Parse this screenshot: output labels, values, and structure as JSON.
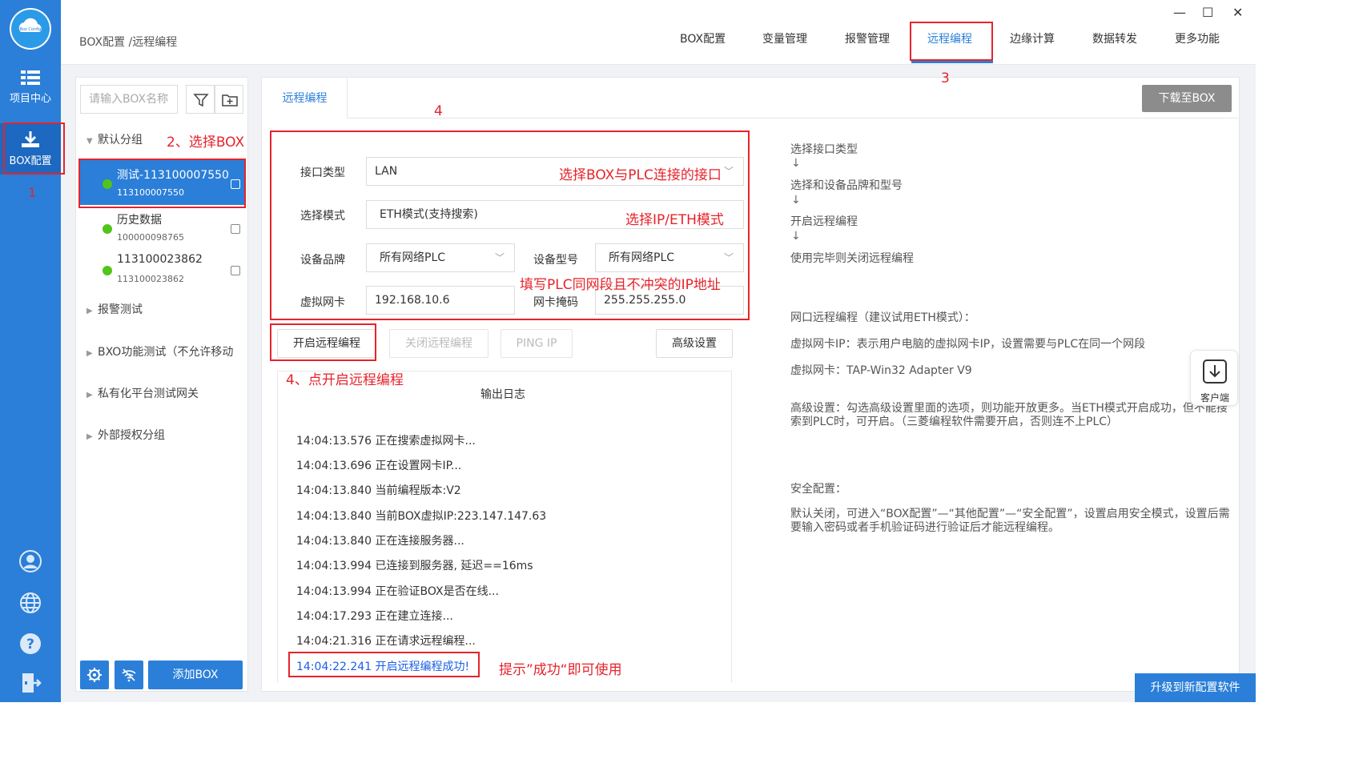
{
  "rail": {
    "logo_text": "Box Config",
    "project_center": "项目中心",
    "box_config": "BOX配置"
  },
  "header": {
    "breadcrumb": "BOX配置 /远程编程",
    "nav": [
      "BOX配置",
      "变量管理",
      "报警管理",
      "远程编程",
      "边缘计算",
      "数据转发",
      "更多功能"
    ],
    "window_controls": [
      "—",
      "☐",
      "✕"
    ]
  },
  "sidebar": {
    "search_placeholder": "请输入BOX名称",
    "groups": [
      "默认分组",
      "报警测试",
      "BXO功能测试（不允许移动",
      "私有化平台测试网关",
      "外部授权分组"
    ],
    "boxes": [
      {
        "name": "测试-113100007550",
        "sn": "113100007550"
      },
      {
        "name": "历史数据",
        "sn": "100000098765"
      },
      {
        "name": "113100023862",
        "sn": "113100023862"
      }
    ],
    "add_box": "添加BOX"
  },
  "main": {
    "tab": "远程编程",
    "download_button": "下载至BOX",
    "form": {
      "interface_label": "接口类型",
      "interface_value": "LAN",
      "mode_label": "选择模式",
      "mode_value": "ETH模式(支持搜索)",
      "brand_label": "设备品牌",
      "brand_value": "所有网络PLC",
      "model_label": "设备型号",
      "model_value": "所有网络PLC",
      "nic_label": "虚拟网卡",
      "nic_value": "192.168.10.6",
      "mask_label": "网卡掩码",
      "mask_value": "255.255.255.0"
    },
    "buttons": {
      "start": "开启远程编程",
      "stop": "关闭远程编程",
      "ping": "PING IP",
      "advanced": "高级设置"
    },
    "log": {
      "title": "输出日志",
      "lines": [
        "14:04:13.576 正在搜索虚拟网卡...",
        "14:04:13.696 正在设置网卡IP...",
        "14:04:13.840 当前编程版本:V2",
        "14:04:13.840 当前BOX虚拟IP:223.147.147.63",
        "14:04:13.840 正在连接服务器...",
        "14:04:13.994 已连接到服务器, 延迟==16ms",
        "14:04:13.994 正在验证BOX是否在线...",
        "14:04:17.293 正在建立连接...",
        "14:04:21.316 正在请求远程编程...",
        "14:04:22.241 开启远程编程成功!"
      ]
    }
  },
  "help": {
    "steps": [
      "选择接口类型",
      "选择和设备品牌和型号",
      "开启远程编程",
      "使用完毕则关闭远程编程"
    ],
    "arrow": "↓",
    "eth_title": "网口远程编程（建议试用ETH模式）：",
    "nic_ip_desc": "虚拟网卡IP：表示用户电脑的虚拟网卡IP，设置需要与PLC在同一个网段",
    "nic_desc": "虚拟网卡：TAP-Win32 Adapter V9",
    "advanced_desc": "高级设置：勾选高级设置里面的选项，则功能开放更多。当ETH模式开启成功，但不能搜索到PLC时，可开启。（三菱编程软件需要开启，否则连不上PLC）",
    "security_title": "安全配置：",
    "security_desc": "默认关闭，可进入“BOX配置”—“其他配置”—“安全配置”，设置启用安全模式，设置后需要输入密码或者手机验证码进行验证后才能远程编程。"
  },
  "annotations": {
    "n1": "1",
    "n2": "2、选择BOX",
    "n3": "3",
    "n4": "4",
    "n4b": "4、点开启远程编程",
    "interface_hint": "选择BOX与PLC连接的接口",
    "mode_hint": "选择IP/ETH模式",
    "ip_hint": "填写PLC同网段且不冲突的IP地址",
    "success_hint": "提示”成功“即可使用"
  },
  "client_label": "客户端",
  "upgrade_button": "升级到新配置软件",
  "colors": {
    "accent": "#2b7fd8",
    "annotation": "#e6232b",
    "success": "#52c41a"
  }
}
